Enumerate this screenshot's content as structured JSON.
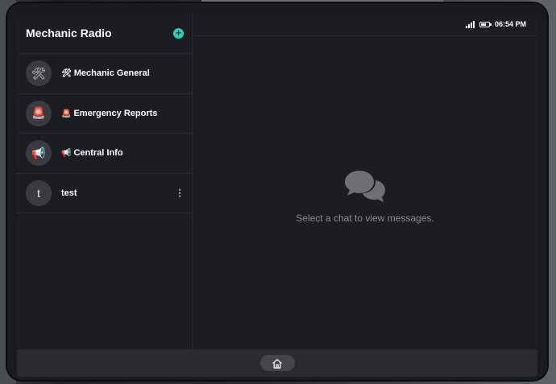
{
  "status": {
    "time": "06:54 PM",
    "signal_bars": 4,
    "battery_level": 0.6
  },
  "sidebar": {
    "title": "Mechanic Radio",
    "add_icon": "plus-icon",
    "chats": [
      {
        "avatar": "🛠",
        "emoji": "🛠",
        "name": "Mechanic General"
      },
      {
        "avatar": "🚨",
        "emoji": "🚨",
        "name": "Emergency Reports"
      },
      {
        "avatar": "📢",
        "emoji": "📢",
        "name": "Central Info"
      },
      {
        "avatar": "t",
        "emoji": "",
        "name": "test"
      }
    ]
  },
  "main": {
    "empty_icon": "chat-bubbles-icon",
    "empty_text": "Select a chat to view messages."
  },
  "nav": {
    "home_icon": "home-icon"
  },
  "colors": {
    "accent": "#20d2b8",
    "panel": "#1c1d21",
    "muted_text": "#8a8c92"
  }
}
